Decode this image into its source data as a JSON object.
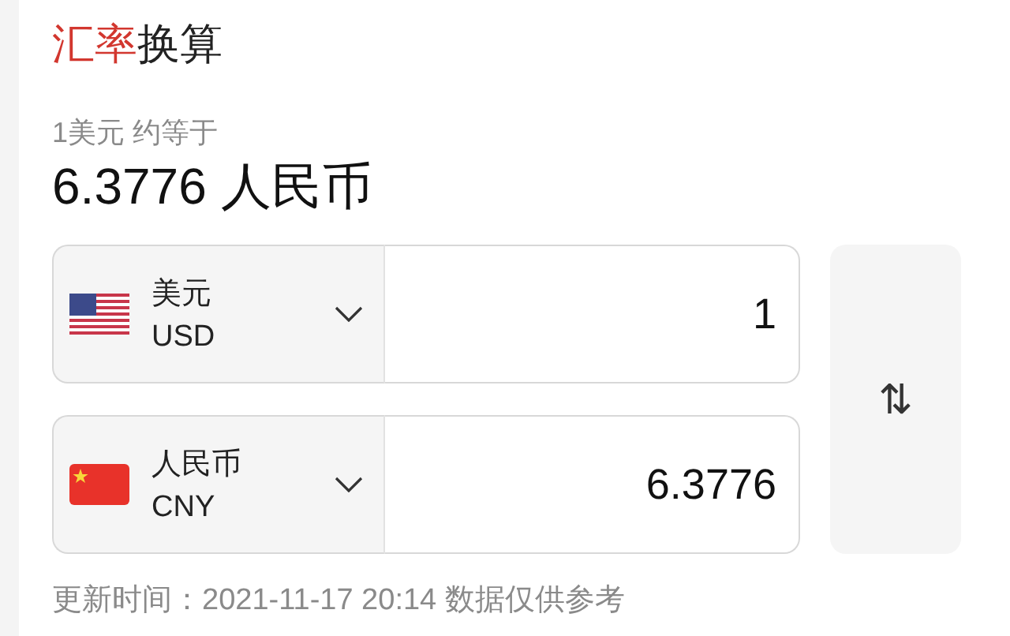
{
  "title": {
    "highlight": "汇率",
    "rest": "换算"
  },
  "rate_caption": "1美元 约等于",
  "rate_value": "6.3776 人民币",
  "currencies": [
    {
      "kind": "us",
      "name": "美元",
      "code": "USD",
      "amount": "1"
    },
    {
      "kind": "cn",
      "name": "人民币",
      "code": "CNY",
      "amount": "6.3776"
    }
  ],
  "swap_icon": "⇅",
  "footer": "更新时间：2021-11-17 20:14 数据仅供参考"
}
